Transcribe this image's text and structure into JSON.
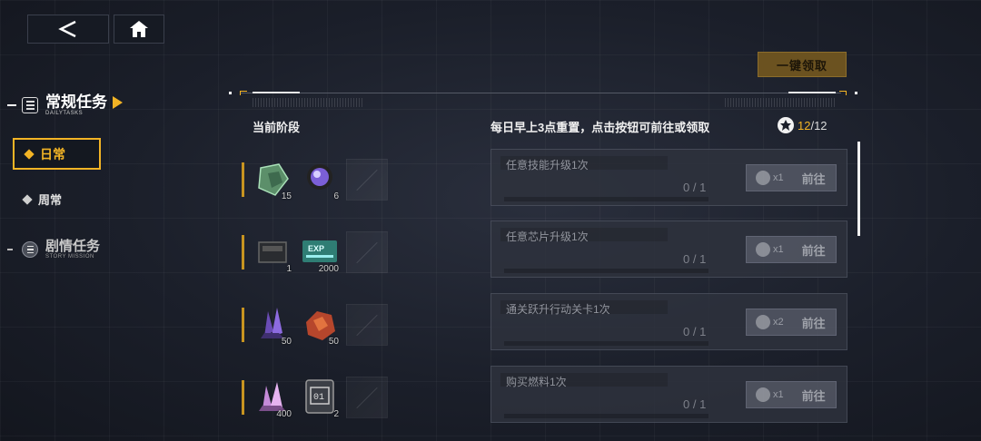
{
  "top_bar": {
    "back_icon": "chevron-left-icon",
    "home_icon": "home-icon"
  },
  "claim_all": {
    "label": "一键领取"
  },
  "nav": {
    "main": {
      "title": "常规任务",
      "subtitle": "DAILYTASKS"
    },
    "subtabs": [
      {
        "label": "日常",
        "active": true
      },
      {
        "label": "周常",
        "active": false
      }
    ],
    "story": {
      "title": "剧情任务",
      "subtitle": "STORY MISSION"
    }
  },
  "header": {
    "stage_label": "当前阶段",
    "info": "每日早上3点重置，点击按钮可前往或领取",
    "count_current": "12",
    "count_total": "/12"
  },
  "stages": [
    {
      "items": [
        {
          "icon": "green-cube-icon",
          "count": "15"
        },
        {
          "icon": "purple-lens-icon",
          "count": "6"
        },
        {
          "icon": "empty-slot",
          "count": ""
        }
      ]
    },
    {
      "items": [
        {
          "icon": "chip-box-icon",
          "count": "1"
        },
        {
          "icon": "exp-card-icon",
          "count": "2000"
        },
        {
          "icon": "empty-slot",
          "count": ""
        }
      ]
    },
    {
      "items": [
        {
          "icon": "purple-crystal-icon",
          "count": "50"
        },
        {
          "icon": "red-ore-icon",
          "count": "50"
        },
        {
          "icon": "empty-slot",
          "count": ""
        }
      ]
    },
    {
      "items": [
        {
          "icon": "pink-crystal-icon",
          "count": "400"
        },
        {
          "icon": "ticket-01-icon",
          "count": "2"
        },
        {
          "icon": "empty-slot",
          "count": ""
        }
      ]
    }
  ],
  "tasks": [
    {
      "title": "任意技能升级1次",
      "progress": "0 / 1",
      "reward_count": "x1",
      "button": "前往"
    },
    {
      "title": "任意芯片升级1次",
      "progress": "0 / 1",
      "reward_count": "x1",
      "button": "前往"
    },
    {
      "title": "通关跃升行动关卡1次",
      "progress": "0 / 1",
      "reward_count": "x2",
      "button": "前往"
    },
    {
      "title": "购买燃料1次",
      "progress": "0 / 1",
      "reward_count": "x1",
      "button": "前往"
    }
  ],
  "colors": {
    "accent": "#f3b425",
    "panel": "#2e323d",
    "background": "#1b1f2a"
  }
}
